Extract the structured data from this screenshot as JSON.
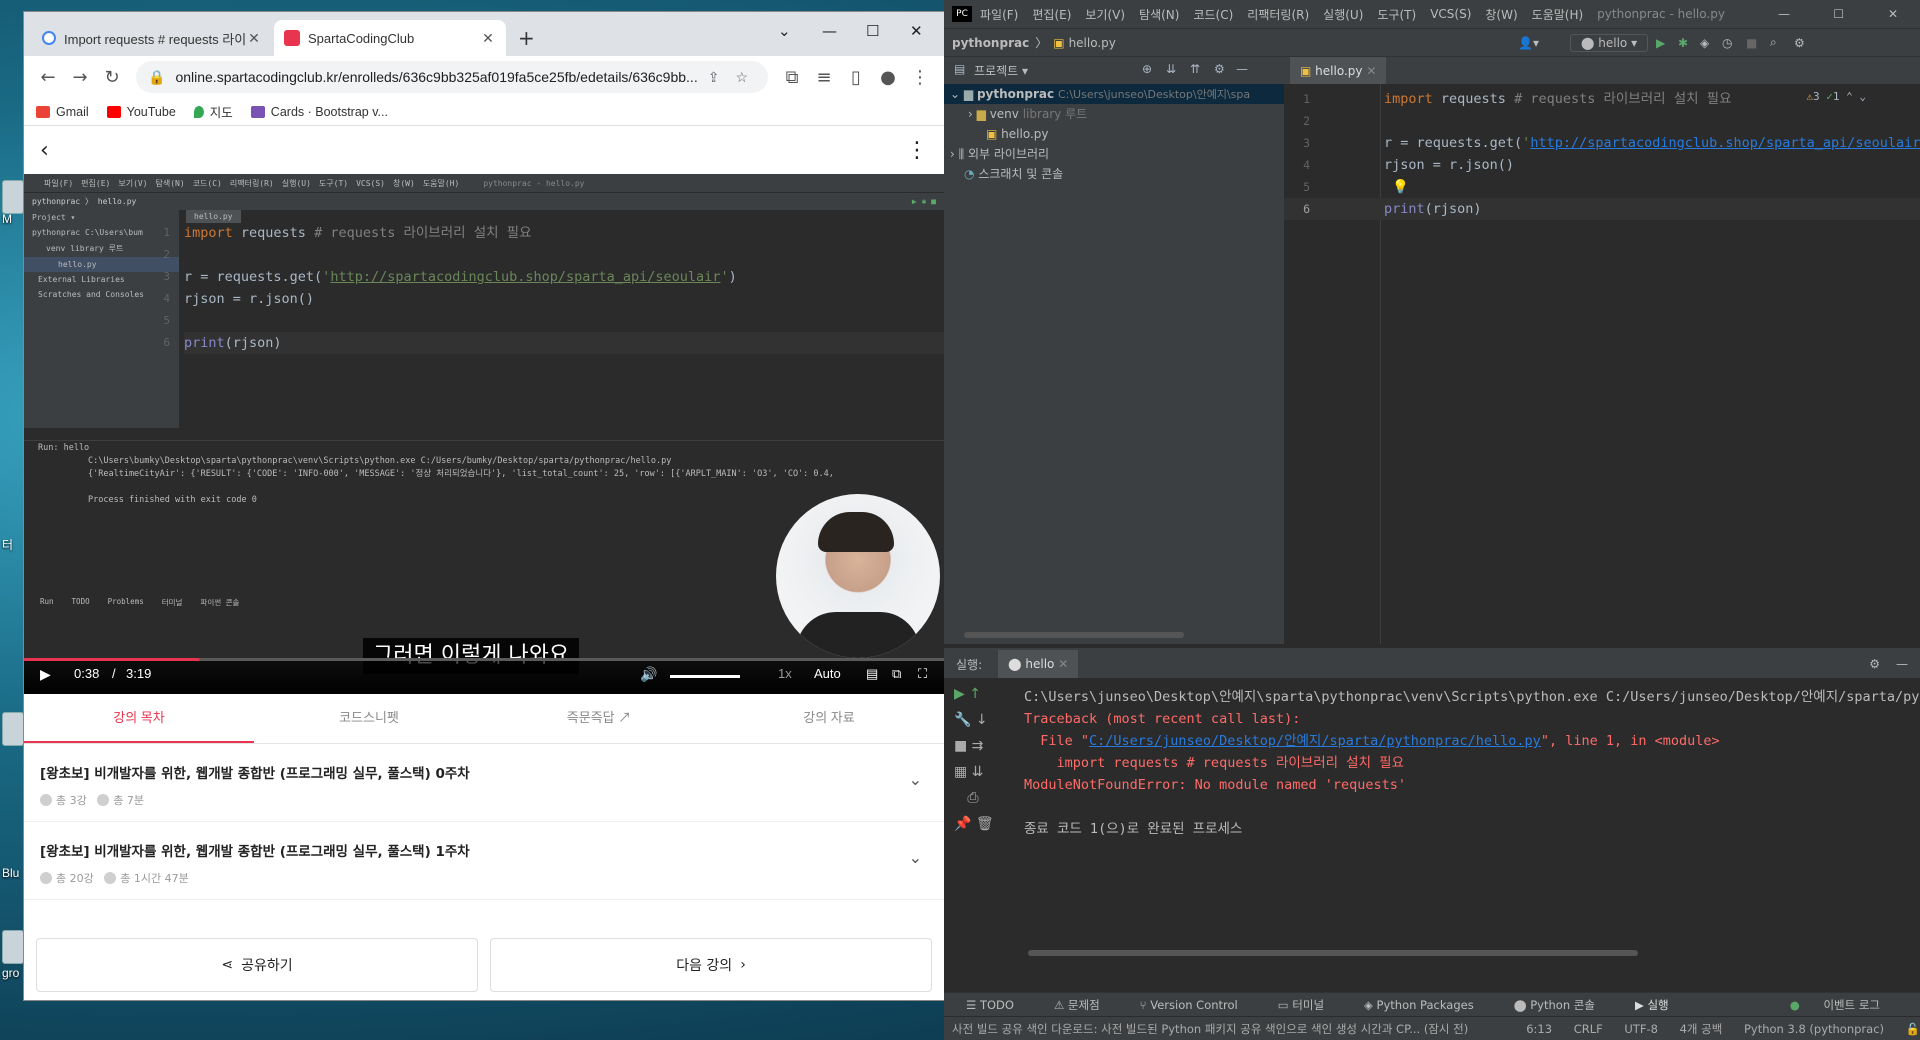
{
  "desktop": {
    "labels": [
      "M",
      "터",
      "Blu",
      "gro"
    ]
  },
  "browser": {
    "tabs": [
      {
        "title": "Import requests # requests 라이",
        "active": false
      },
      {
        "title": "SpartaCodingClub",
        "active": true
      }
    ],
    "url": "online.spartacodingclub.kr/enrolleds/636c9bb325af019fa5ce25fb/edetails/636c9bb...",
    "bookmarks": [
      "Gmail",
      "YouTube",
      "지도",
      "Cards · Bootstrap v..."
    ]
  },
  "video": {
    "embedded_ide": {
      "menu": [
        "파일(F)",
        "편집(E)",
        "보기(V)",
        "탐색(N)",
        "코드(C)",
        "리팩터링(R)",
        "실행(U)",
        "도구(T)",
        "VCS(S)",
        "창(W)",
        "도움말(H)"
      ],
      "window_title": "pythonprac - hello.py",
      "breadcrumb": "pythonprac 〉 hello.py",
      "project_items": [
        "Project ▾",
        "pythonprac  C:\\Users\\bum",
        "venv  library 루트",
        "hello.py",
        "External Libraries",
        "Scratches and Consoles"
      ],
      "file_tab": "hello.py",
      "code_lines": [
        "import requests # requests 라이브러리 설치 필요",
        "",
        "r = requests.get('http://spartacodingclub.shop/sparta_api/seoulair')",
        "rjson = r.json()",
        "",
        "print(rjson)"
      ],
      "run_label": "Run:  hello",
      "run_output": "C:\\Users\\bumky\\Desktop\\sparta\\pythonprac\\venv\\Scripts\\python.exe C:/Users/bumky/Desktop/sparta/pythonprac/hello.py\n{'RealtimeCityAir': {'RESULT': {'CODE': 'INFO-000', 'MESSAGE': '정상 처리되었습니다'}, 'list_total_count': 25, 'row': [{'ARPLT_MAIN': 'O3', 'CO': 0.4,\n\nProcess finished with exit code 0",
      "bottom_tabs": [
        "Run",
        "TODO",
        "Problems",
        "터미널",
        "파이썬 콘솔"
      ]
    },
    "subtitle": "그러면 이렇게 나와요",
    "time_current": "0:38",
    "time_total": "3:19",
    "progress": 0.19,
    "speed": "1x",
    "quality": "Auto"
  },
  "lecture_tabs": [
    "강의 목차",
    "코드스니펫",
    "즉문즉답",
    "강의 자료"
  ],
  "weeks": [
    {
      "title": "[왕초보] 비개발자를 위한, 웹개발 종합반 (프로그래밍 실무, 풀스택) 0주차",
      "lessons": "총 3강",
      "duration": "총 7분"
    },
    {
      "title": "[왕초보] 비개발자를 위한, 웹개발 종합반 (프로그래밍 실무, 풀스택) 1주차",
      "lessons": "총 20강",
      "duration": "총 1시간 47분"
    }
  ],
  "buttons": {
    "share": "공유하기",
    "next": "다음 강의"
  },
  "ide": {
    "menu": [
      "파일(F)",
      "편집(E)",
      "보기(V)",
      "탐색(N)",
      "코드(C)",
      "리팩터링(R)",
      "실행(U)",
      "도구(T)",
      "VCS(S)",
      "창(W)",
      "도움말(H)"
    ],
    "window_title": "pythonprac - hello.py",
    "breadcrumb": [
      "pythonprac",
      "hello.py"
    ],
    "run_config": "hello",
    "project_header": "프로젝트",
    "tree": [
      {
        "name": "pythonprac",
        "detail": "C:\\Users\\junseo\\Desktop\\안예지\\spa"
      },
      {
        "name": "venv",
        "detail": "library 루트"
      },
      {
        "name": "hello.py",
        "detail": ""
      },
      {
        "name": "외부 라이브러리",
        "detail": ""
      },
      {
        "name": "스크래치 및 콘솔",
        "detail": ""
      }
    ],
    "editor_tab": "hello.py",
    "inspections": {
      "warnings": "3",
      "ok": "1"
    },
    "code": {
      "line1_kw": "import",
      "line1_mod": " requests",
      "line1_cm": " # requests 라이브러리 설치 필요",
      "line3_pre": "r = requests.get(",
      "line3_url": "http://spartacodingclub.shop/sparta_api/seoulair",
      "line3_post": ")",
      "line4": "rjson = r.json()",
      "line6_fn": "print",
      "line6_arg": "(rjson)"
    },
    "run_label": "실행:",
    "run_tab": "hello",
    "run_output": {
      "cmd": "C:\\Users\\junseo\\Desktop\\안예지\\sparta\\pythonprac\\venv\\Scripts\\python.exe C:/Users/junseo/Desktop/안예지/sparta/py",
      "tb": "Traceback (most recent call last):",
      "file_pre": "  File \"",
      "file_link": "C:/Users/junseo/Desktop/안예지/sparta/pythonprac/hello.py",
      "file_post": "\", line 1, in <module>",
      "src": "    import requests # requests 라이브러리 설치 필요",
      "error": "ModuleNotFoundError: No module named 'requests'",
      "exit": "종료 코드 1(으)로 완료된 프로세스"
    },
    "bottom_tabs": [
      "TODO",
      "문제점",
      "Version Control",
      "터미널",
      "Python Packages",
      "Python 콘솔",
      "실행"
    ],
    "event_log": "이벤트 로그",
    "status_message": "사전 빌드 공유 색인 다운로드: 사전 빌드된 Python 패키지 공유 색인으로 색인 생성 시간과 CP... (잠시 전)",
    "status_right": [
      "6:13",
      "CRLF",
      "UTF-8",
      "4개 공백",
      "Python 3.8 (pythonprac)"
    ]
  }
}
